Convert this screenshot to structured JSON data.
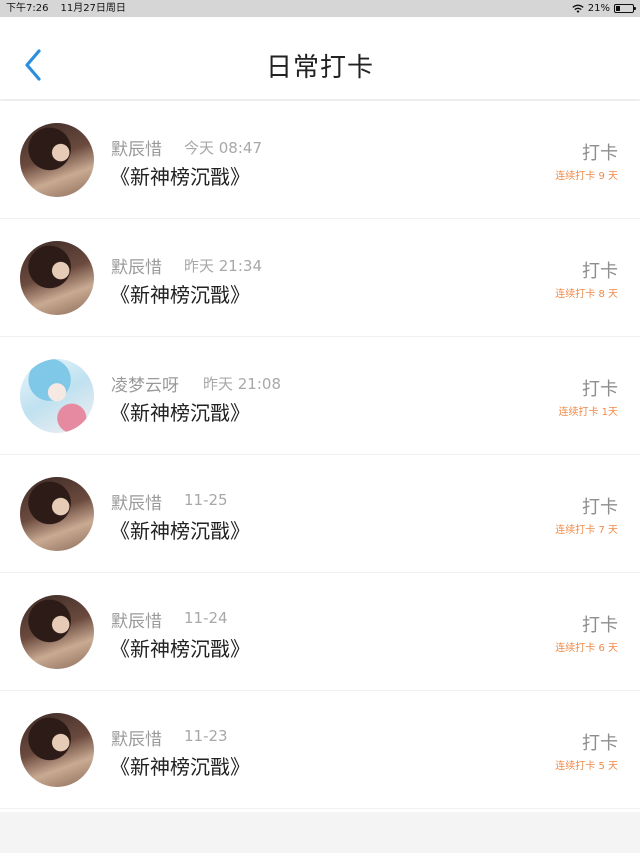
{
  "status_bar": {
    "time": "下午7:26",
    "date": "11月27日周日",
    "battery": "21%"
  },
  "header": {
    "title": "日常打卡",
    "back_icon": "chevron-left-icon"
  },
  "colors": {
    "accent": "#2a8fe0",
    "streak": "#f08a48"
  },
  "items": [
    {
      "user": "默辰惜",
      "time": "今天 08:47",
      "title": "《新神榜沉戬》",
      "action": "打卡",
      "streak": "连续打卡 9 天",
      "avatar": "dark"
    },
    {
      "user": "默辰惜",
      "time": "昨天 21:34",
      "title": "《新神榜沉戬》",
      "action": "打卡",
      "streak": "连续打卡 8 天",
      "avatar": "dark"
    },
    {
      "user": "凌梦云呀",
      "time": "昨天 21:08",
      "title": "《新神榜沉戬》",
      "action": "打卡",
      "streak": "连续打卡 1天",
      "avatar": "light"
    },
    {
      "user": "默辰惜",
      "time": "11-25",
      "title": "《新神榜沉戬》",
      "action": "打卡",
      "streak": "连续打卡 7 天",
      "avatar": "dark"
    },
    {
      "user": "默辰惜",
      "time": "11-24",
      "title": "《新神榜沉戬》",
      "action": "打卡",
      "streak": "连续打卡 6 天",
      "avatar": "dark"
    },
    {
      "user": "默辰惜",
      "time": "11-23",
      "title": "《新神榜沉戬》",
      "action": "打卡",
      "streak": "连续打卡 5 天",
      "avatar": "dark"
    }
  ]
}
